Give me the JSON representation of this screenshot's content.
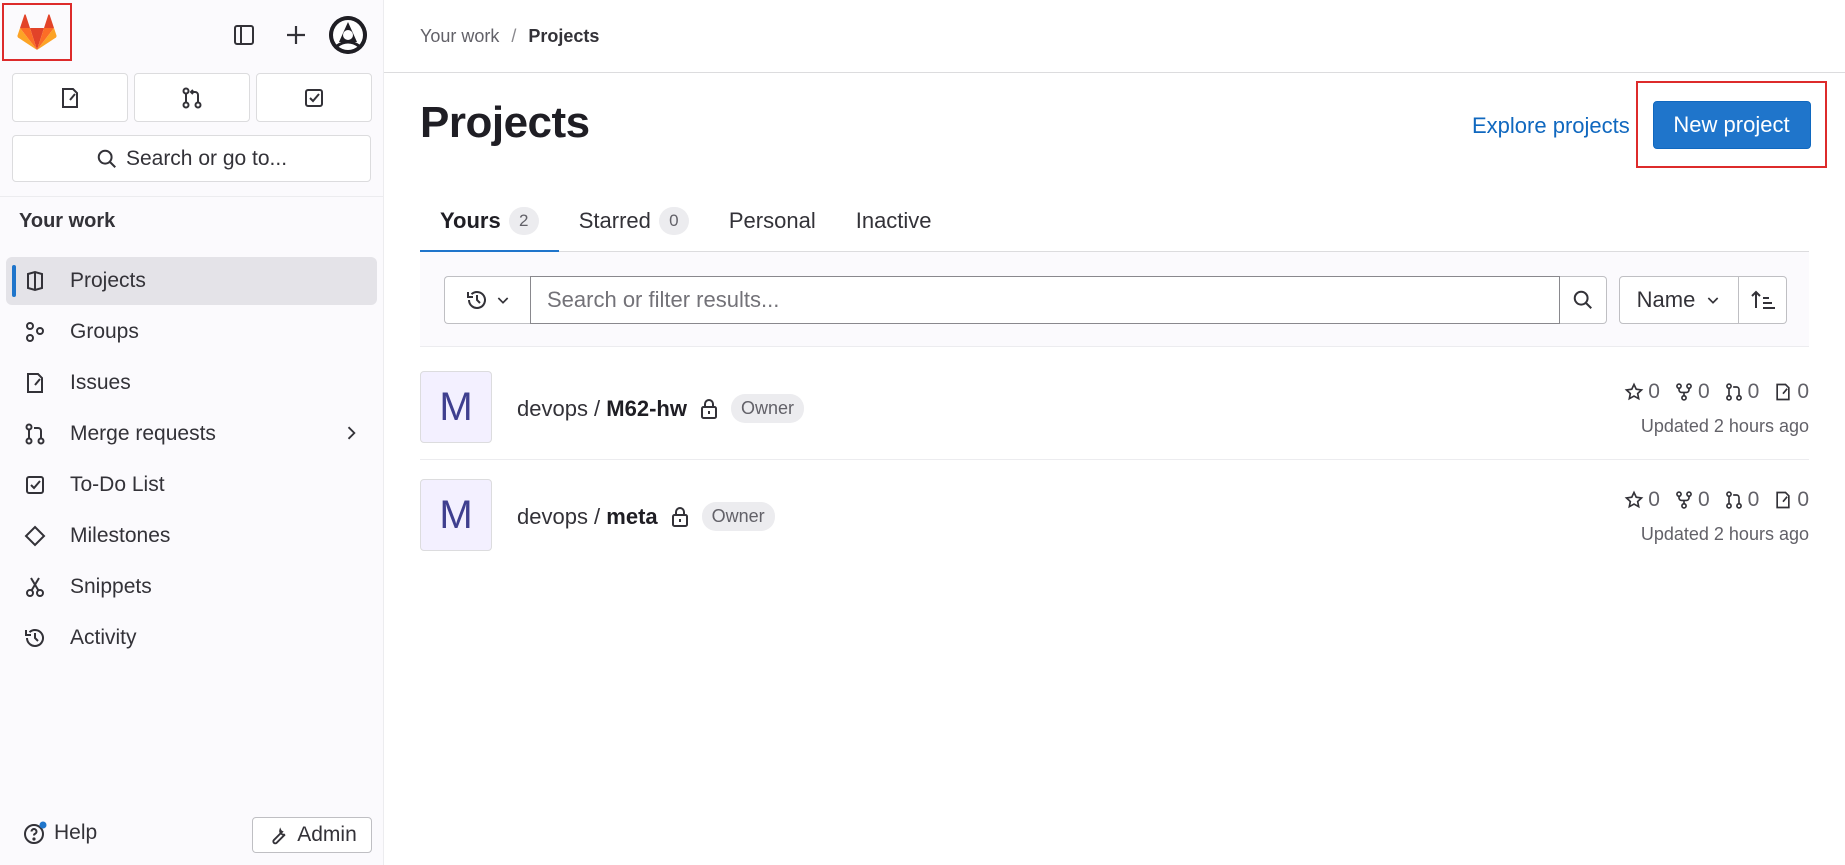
{
  "sidebar": {
    "search_label": "Search or go to...",
    "section_title": "Your work",
    "items": [
      {
        "label": "Projects",
        "icon": "project-icon",
        "active": true
      },
      {
        "label": "Groups",
        "icon": "group-icon"
      },
      {
        "label": "Issues",
        "icon": "issues-icon"
      },
      {
        "label": "Merge requests",
        "icon": "merge-request-icon"
      },
      {
        "label": "To-Do List",
        "icon": "todo-icon"
      },
      {
        "label": "Milestones",
        "icon": "milestone-icon"
      },
      {
        "label": "Snippets",
        "icon": "snippet-icon"
      },
      {
        "label": "Activity",
        "icon": "history-icon"
      }
    ],
    "help_label": "Help",
    "admin_label": "Admin"
  },
  "breadcrumb": {
    "parent": "Your work",
    "current": "Projects"
  },
  "header": {
    "title": "Projects",
    "explore_label": "Explore projects",
    "new_project_label": "New project"
  },
  "tabs": [
    {
      "label": "Yours",
      "count": "2"
    },
    {
      "label": "Starred",
      "count": "0"
    },
    {
      "label": "Personal"
    },
    {
      "label": "Inactive"
    }
  ],
  "filter": {
    "placeholder": "Search or filter results...",
    "sort_label": "Name"
  },
  "projects": [
    {
      "avatar": "M",
      "namespace": "devops / ",
      "name": "M62-hw",
      "role": "Owner",
      "stars": "0",
      "forks": "0",
      "mrs": "0",
      "issues": "0",
      "updated": "Updated 2 hours ago"
    },
    {
      "avatar": "M",
      "namespace": "devops / ",
      "name": "meta",
      "role": "Owner",
      "stars": "0",
      "forks": "0",
      "mrs": "0",
      "issues": "0",
      "updated": "Updated 2 hours ago"
    }
  ],
  "colors": {
    "accent": "#1f75cb",
    "link": "#1068bf",
    "highlight_border": "#dd2b2b"
  }
}
